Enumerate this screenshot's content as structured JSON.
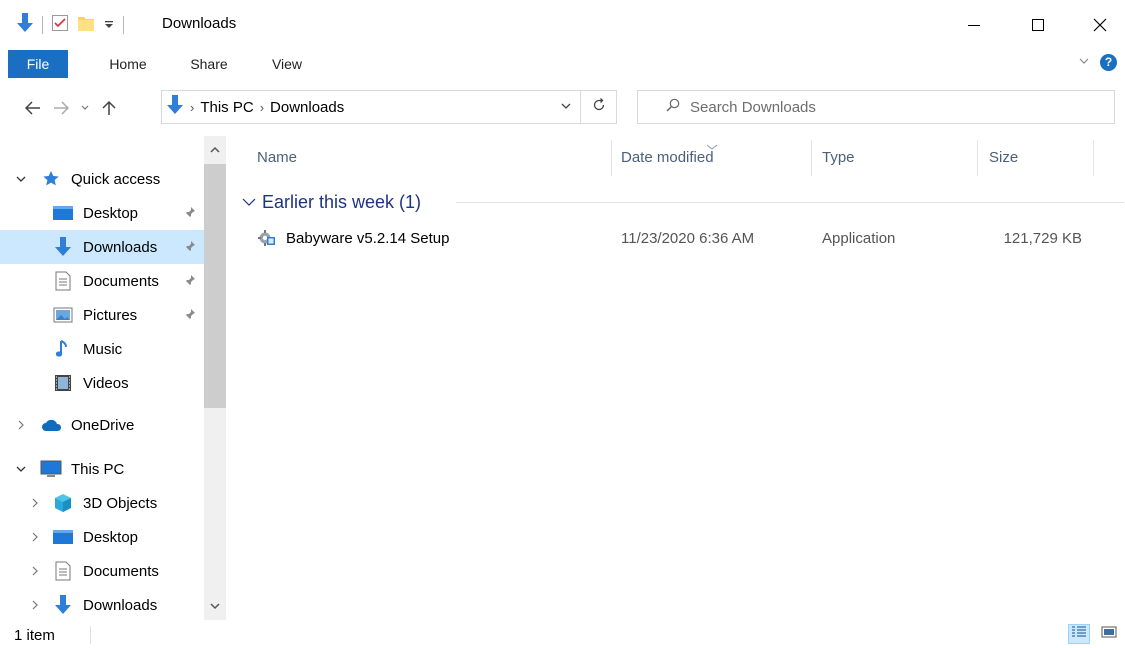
{
  "window": {
    "title": "Downloads"
  },
  "ribbon": {
    "tabs": [
      "File",
      "Home",
      "Share",
      "View"
    ],
    "help_label": "?"
  },
  "address": {
    "crumbs": [
      "This PC",
      "Downloads"
    ]
  },
  "search": {
    "placeholder": "Search Downloads"
  },
  "sidebar": {
    "quick_access": {
      "label": "Quick access",
      "items": [
        {
          "label": "Desktop",
          "icon": "desktop-icon",
          "pinned": true
        },
        {
          "label": "Downloads",
          "icon": "downloads-icon",
          "pinned": true,
          "selected": true
        },
        {
          "label": "Documents",
          "icon": "documents-icon",
          "pinned": true
        },
        {
          "label": "Pictures",
          "icon": "pictures-icon",
          "pinned": true
        },
        {
          "label": "Music",
          "icon": "music-icon",
          "pinned": false
        },
        {
          "label": "Videos",
          "icon": "videos-icon",
          "pinned": false
        }
      ]
    },
    "onedrive": {
      "label": "OneDrive"
    },
    "this_pc": {
      "label": "This PC",
      "items": [
        {
          "label": "3D Objects",
          "icon": "3d-objects-icon"
        },
        {
          "label": "Desktop",
          "icon": "desktop-icon"
        },
        {
          "label": "Documents",
          "icon": "documents-icon"
        },
        {
          "label": "Downloads",
          "icon": "downloads-icon"
        }
      ]
    }
  },
  "columns": [
    "Name",
    "Date modified",
    "Type",
    "Size"
  ],
  "groups": [
    {
      "label": "Earlier this week (1)",
      "files": [
        {
          "name": "Babyware v5.2.14 Setup",
          "date_modified": "11/23/2020 6:36 AM",
          "type": "Application",
          "size": "121,729 KB"
        }
      ]
    }
  ],
  "status": {
    "item_count": "1 item"
  },
  "colors": {
    "accent": "#1a6fc2",
    "selection": "#cce8ff",
    "group_header": "#1e3287",
    "column_header": "#4c607a"
  }
}
